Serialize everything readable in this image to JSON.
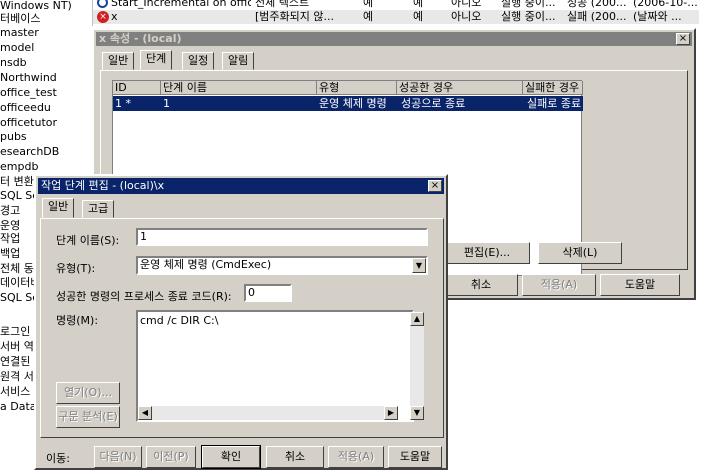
{
  "tree": {
    "items": [
      "Windows NT)",
      "터베이스",
      "master",
      "model",
      "nsdb",
      "Northwind",
      "office_test",
      "officeedu",
      "officetutor",
      "pubs",
      "esearchDB",
      "empdb",
      "터 변환 서비스",
      "SQL Ser",
      "경고",
      "운영",
      "작업",
      "백업",
      "전체 동",
      "데이터베",
      "SQL Ser",
      "",
      "로그인",
      "서버 역할",
      "연결된 서",
      "원격 서버",
      "서비스",
      "a Data S"
    ]
  },
  "top_list": {
    "rows": [
      {
        "name": "Start_Incremental on offic...",
        "category": "전체 텍스트",
        "enabled": "예",
        "runnable": "예",
        "scheduled": "아니오",
        "status": "실행 중이...",
        "last_result": "성공 (200...",
        "next_run": "(2006-10-..."
      },
      {
        "name": "x",
        "category": "[범주화되지 않...",
        "enabled": "예",
        "runnable": "예",
        "scheduled": "아니오",
        "status": "실행 중이...",
        "last_result": "실패 (200...",
        "next_run": "(날짜와 ..."
      }
    ]
  },
  "props_window": {
    "title": "x 속성 - (local)",
    "tabs": [
      "일반",
      "단계",
      "일정",
      "알림"
    ],
    "active_tab": "단계",
    "columns": [
      "ID",
      "단계 이름",
      "유형",
      "성공한 경우",
      "실패한 경우"
    ],
    "steps": [
      {
        "id": "1",
        "name": "1",
        "type": "운영 체제 명령",
        "on_success": "성공으로 종료",
        "on_failure": "실패로 종료"
      }
    ],
    "edit_button": "편집(E)...",
    "delete_button": "삭제(L)",
    "cancel_button": "취소",
    "apply_button": "적용(A)",
    "help_button": "도움말"
  },
  "edit_dialog": {
    "title": "작업 단계 편집 - (local)\\x",
    "tabs": [
      "일반",
      "고급"
    ],
    "active_tab": "일반",
    "step_name_label": "단계 이름(S):",
    "step_name_value": "1",
    "type_label": "유형(T):",
    "type_value": "운영 체제 명령 (CmdExec)",
    "exit_code_label": "성공한 명령의 프로세스 종료 코드(R):",
    "exit_code_value": "0",
    "command_label": "명령(M):",
    "command_value": "cmd /c DIR C:\\",
    "open_button": "열기(O)...",
    "parse_button": "구문 분석(E)",
    "move_label": "이동:",
    "next_button": "다음(N)",
    "prev_button": "이전(P)",
    "ok_button": "확인",
    "cancel_button": "취소",
    "apply_button": "적용(A)",
    "help_button": "도움말"
  }
}
